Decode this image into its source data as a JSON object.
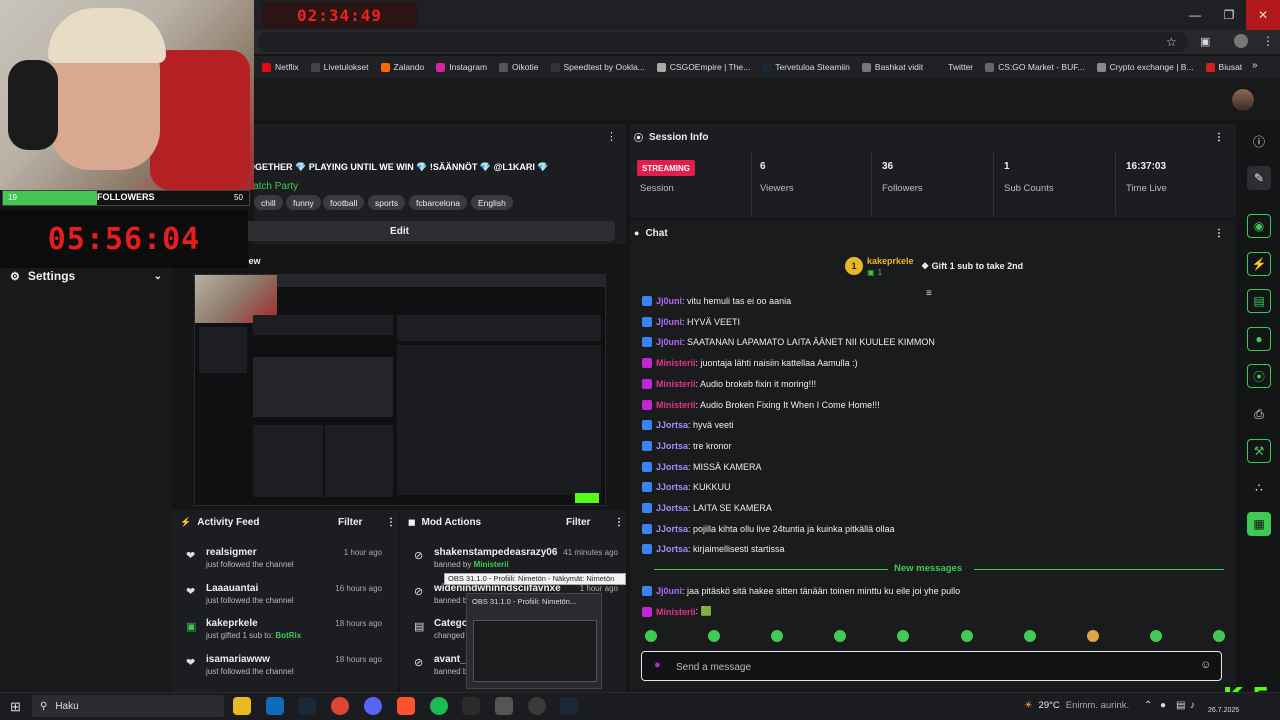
{
  "browser": {
    "top_timer": "02:34:49",
    "bookmarks": [
      {
        "label": "Netflix",
        "color": "#e50914"
      },
      {
        "label": "Livetulokset",
        "color": "#444444"
      },
      {
        "label": "Zalando",
        "color": "#ff6900"
      },
      {
        "label": "Instagram",
        "color": "#d6249f"
      },
      {
        "label": "Oikotie",
        "color": "#555555"
      },
      {
        "label": "Speedtest by Ookla...",
        "color": "#333333"
      },
      {
        "label": "CSGOEmpire | The...",
        "color": "#aaaaaa"
      },
      {
        "label": "Tervetuloa Steamiin",
        "color": "#1b2838"
      },
      {
        "label": "Bashkat vidit",
        "color": "#777777"
      },
      {
        "label": "Twitter",
        "color": "#222222"
      },
      {
        "label": "CS:GO Market - BUF...",
        "color": "#666666"
      },
      {
        "label": "Crypto exchange | B...",
        "color": "#888888"
      },
      {
        "label": "Biusat",
        "color": "#cc2222"
      }
    ]
  },
  "overlay": {
    "followers_label": "FOLLOWERS",
    "followers_current": "19",
    "followers_goal": "50",
    "countdown": "05:56:04"
  },
  "sidebar": {
    "settings_label": "Settings"
  },
  "stream_info": {
    "title": "OGETHER 💎 PLAYING UNTIL WE WIN 💎 !SÄÄNNÖT 💎 @L1KARI 💎",
    "category": "Other, Watch Party",
    "language": "Finnish",
    "tags": [
      "chill",
      "funny",
      "football",
      "sports",
      "fcbarcelona",
      "English"
    ],
    "edit_label": "Edit",
    "preview_label": "iew"
  },
  "activity_feed": {
    "title": "Activity Feed",
    "filter_label": "Filter",
    "items": [
      {
        "name": "realsigmer",
        "sub": "just followed the channel",
        "time": "1 hour ago",
        "icon": "heart-icon"
      },
      {
        "name": "Laaauantai",
        "sub": "just followed the channel",
        "time": "16 hours ago",
        "icon": "heart-icon"
      },
      {
        "name": "kakeprkele",
        "sub_prefix": "just gifted 1 sub to: ",
        "sub_target": "BotRix",
        "time": "18 hours ago",
        "icon": "gift-icon"
      },
      {
        "name": "isamariawww",
        "sub": "just followed the channel",
        "time": "18 hours ago",
        "icon": "heart-icon"
      }
    ]
  },
  "mod_actions": {
    "title": "Mod Actions",
    "filter_label": "Filter",
    "items": [
      {
        "name": "shakenstampedeasrazy06",
        "time": "41 minutes ago",
        "sub_prefix": "banned by ",
        "sub_target": "Ministerii"
      },
      {
        "name": "widenindwhinndsciifavnxe",
        "time": "1 hour ago",
        "sub_prefix": "banned b",
        "sub_target": ""
      },
      {
        "name": "Categor",
        "time": "",
        "sub_prefix": "changed",
        "sub_target": ""
      },
      {
        "name": "avant_g",
        "time": "",
        "sub_prefix": "banned b",
        "sub_target": ""
      }
    ]
  },
  "session_info": {
    "title": "Session Info",
    "badge": "STREAMING",
    "stats": [
      {
        "label": "Session",
        "value": ""
      },
      {
        "label": "Viewers",
        "value": "6"
      },
      {
        "label": "Followers",
        "value": "36"
      },
      {
        "label": "Sub Counts",
        "value": "1"
      },
      {
        "label": "Time Live",
        "value": "16:37:03"
      }
    ]
  },
  "chat": {
    "title": "Chat",
    "pinned_user": "kakeprkele",
    "pinned_count": "1",
    "pinned_rank": "1",
    "pinned_text": "Gift 1 sub to take 2nd",
    "messages": [
      {
        "user": "Jj0uni",
        "text": ": vitu hemuli tas ei oo aania",
        "color": "#b06af5",
        "badge": "#3b82f6"
      },
      {
        "user": "Jj0uni",
        "text": ": HYVÄ VEETI",
        "color": "#b06af5",
        "badge": "#3b82f6"
      },
      {
        "user": "Jj0uni",
        "text": ": SAATANAN LAPAMATO LAITA ÄÄNET NII KUULEE KIMMON",
        "color": "#b06af5",
        "badge": "#3b82f6"
      },
      {
        "user": "Ministerii",
        "text": ": juontaja lähti naisiin kattellaa Aamulla :)",
        "color": "#e0368a",
        "badge": "#c026d3"
      },
      {
        "user": "Ministerii",
        "text": ": Audio brokeb fixin it moring!!!",
        "color": "#e0368a",
        "badge": "#c026d3"
      },
      {
        "user": "Ministerii",
        "text": ": Audio Broken Fixing It When I Come Home!!!",
        "color": "#e0368a",
        "badge": "#c026d3"
      },
      {
        "user": "JJortsa",
        "text": ": hyvä veeti",
        "color": "#a78bfa",
        "badge": "#3b82f6"
      },
      {
        "user": "JJortsa",
        "text": ": tre kronor",
        "color": "#a78bfa",
        "badge": "#3b82f6"
      },
      {
        "user": "JJortsa",
        "text": ": MISSÄ KAMERA",
        "color": "#a78bfa",
        "badge": "#3b82f6"
      },
      {
        "user": "JJortsa",
        "text": ": KUKKUU",
        "color": "#a78bfa",
        "badge": "#3b82f6"
      },
      {
        "user": "JJortsa",
        "text": ": LAITA SE KAMERA",
        "color": "#a78bfa",
        "badge": "#3b82f6"
      },
      {
        "user": "JJortsa",
        "text": ": pojilla kihta ollu live 24tuntia ja kuinka pitkällä ollaa",
        "color": "#a78bfa",
        "badge": "#3b82f6"
      },
      {
        "user": "JJortsa",
        "text": ": kirjaimellisesti startissa",
        "color": "#a78bfa",
        "badge": "#3b82f6"
      }
    ],
    "new_messages_label": "New messages",
    "new_messages": [
      {
        "user": "Jj0uni",
        "text": ": jaa pitäskö sitä hakee sitten tänään toinen minttu ku eile joi yhe pullo",
        "color": "#b06af5",
        "badge": "#3b82f6"
      },
      {
        "user": "Ministerii",
        "text": ": 🟩",
        "color": "#e0368a",
        "badge": "#c026d3"
      }
    ],
    "input_placeholder": "Send a message"
  },
  "obs": {
    "tooltip": "OBS 31.1.0 - Profiili: Nimetön - Näkymät: Nimetön",
    "thumb_title": "OBS 31.1.0 - Profiili: Nimetön..."
  },
  "kick_logo": "K 5",
  "taskbar": {
    "search_label": "Haku",
    "weather_temp": "29°C",
    "weather_text": "Enimm. aurink.",
    "date_fragment": "26.7.2025"
  },
  "colors": {
    "accent": "#3fca54",
    "kick_green": "#53fc18",
    "live_red": "#e01f4c"
  }
}
